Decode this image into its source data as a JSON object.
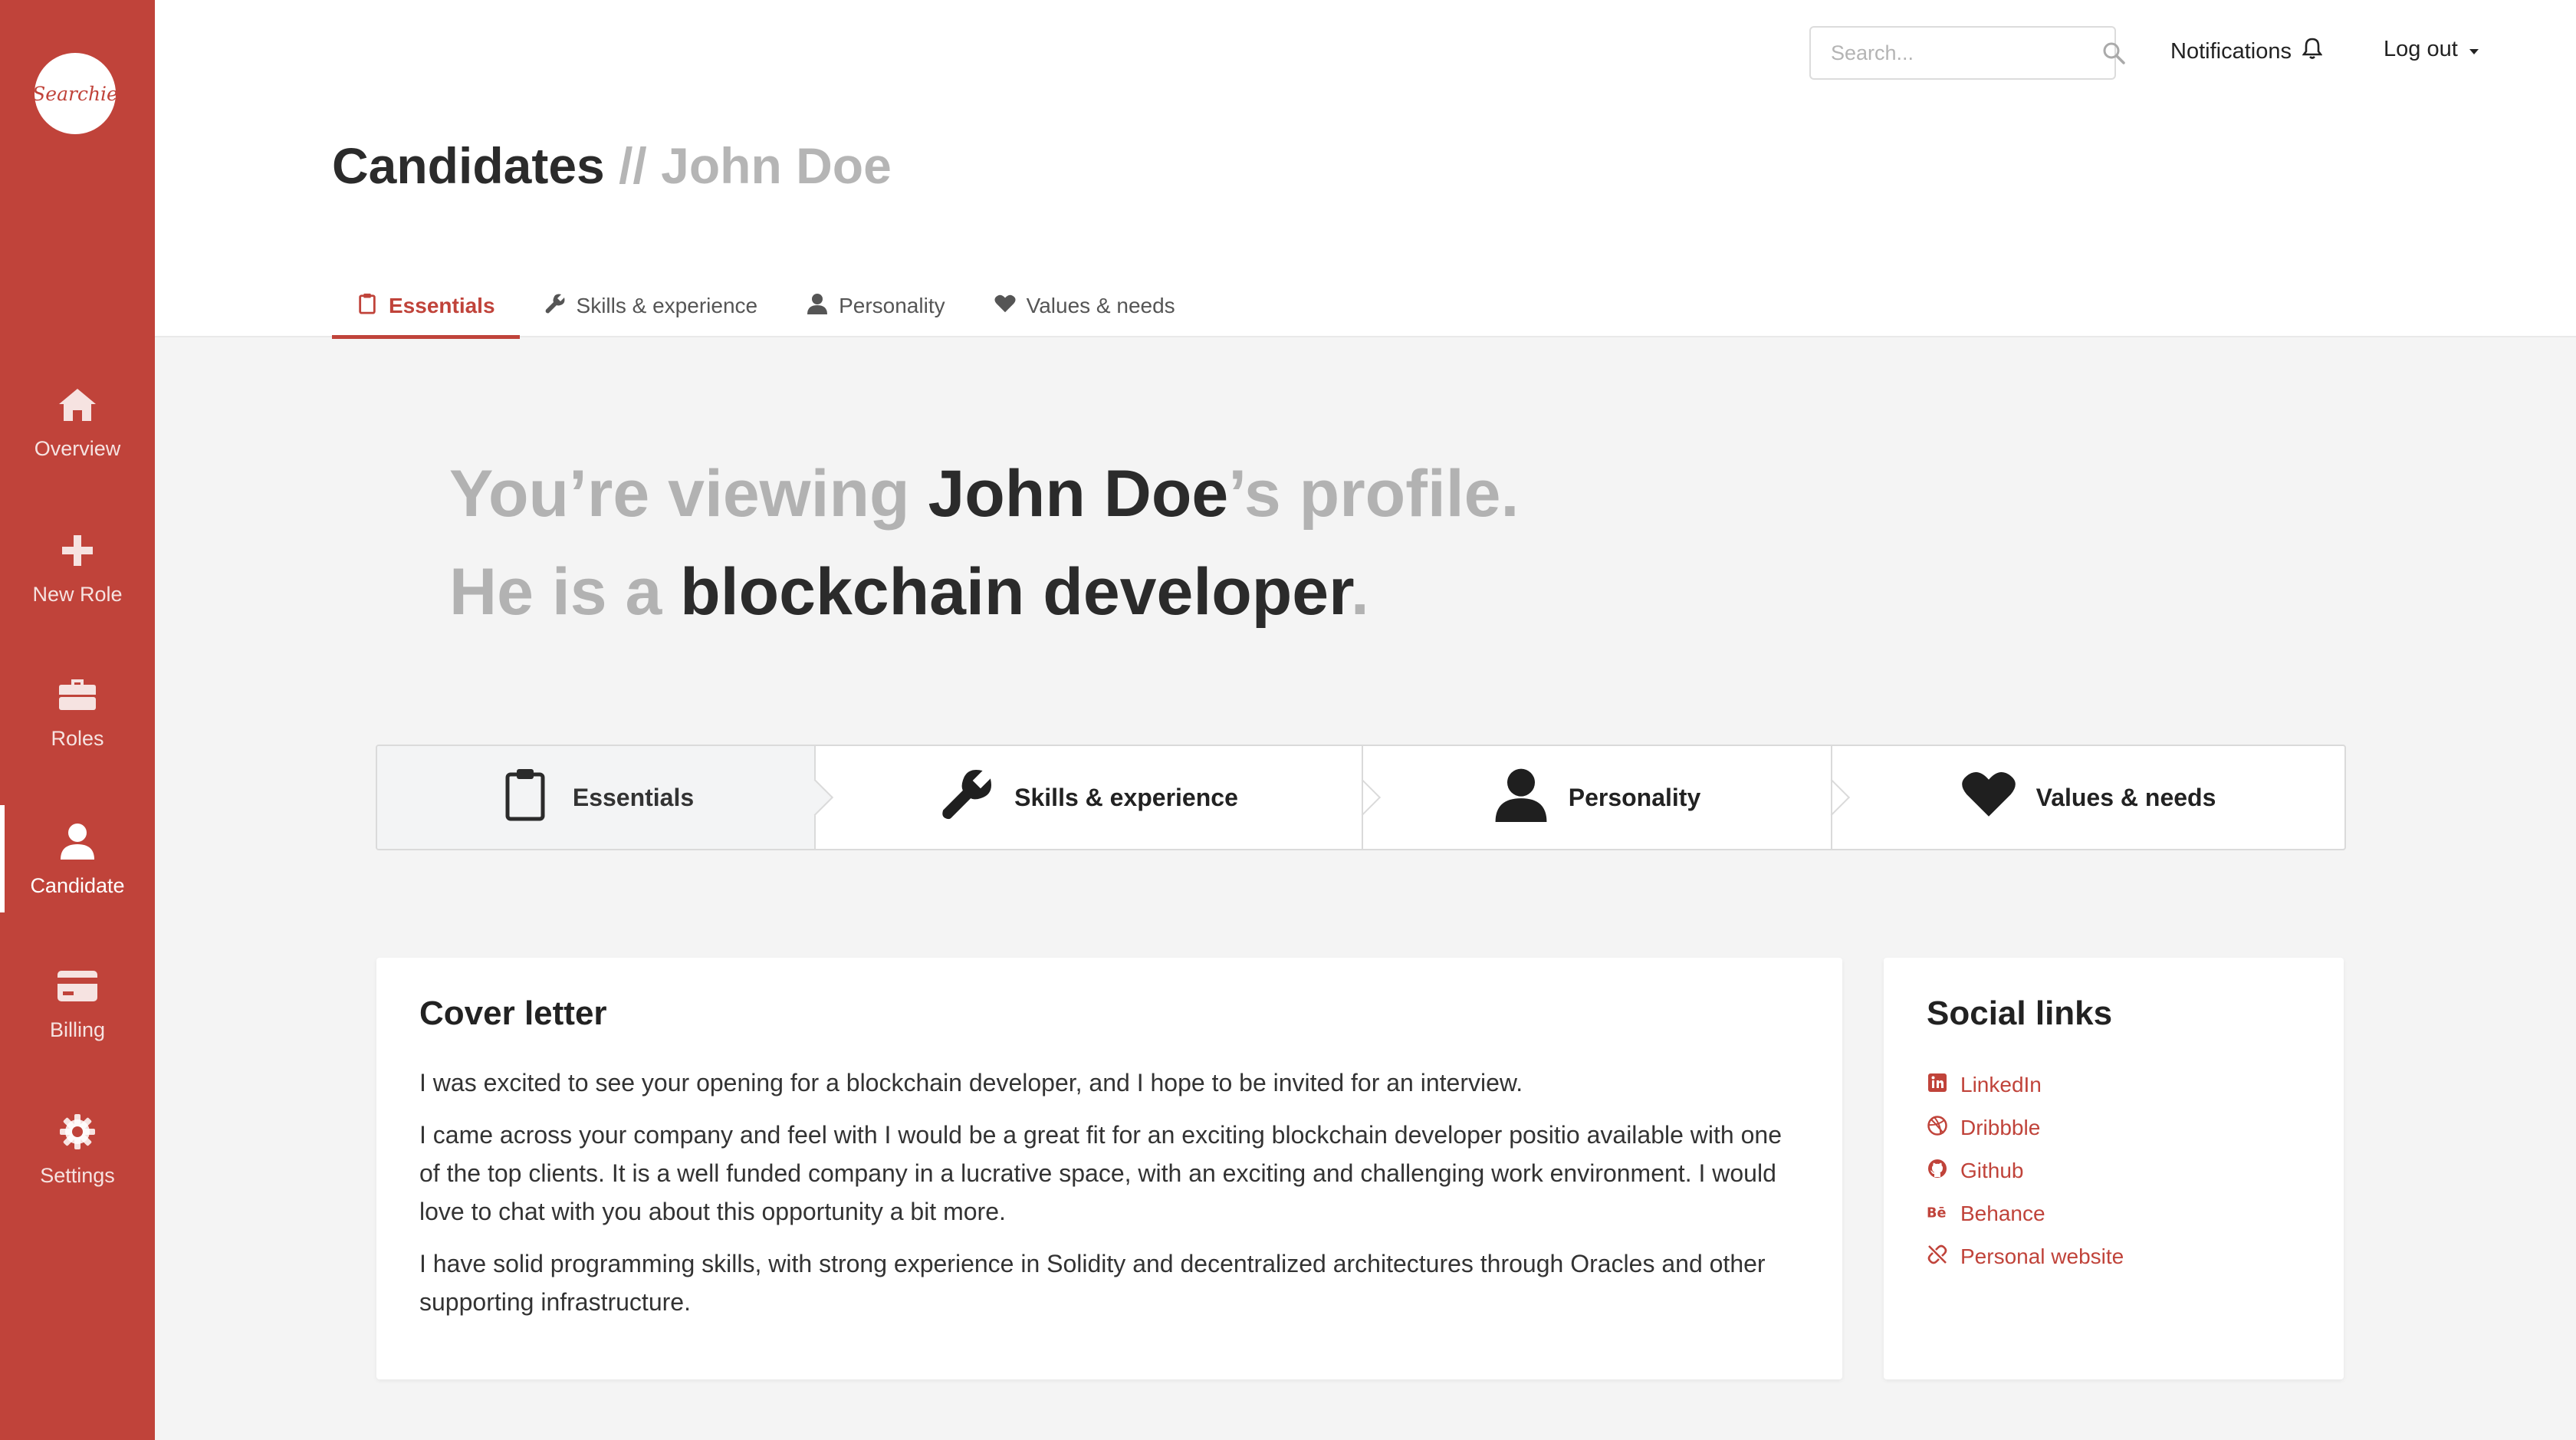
{
  "brand": {
    "logo_text": "Searchie",
    "accent": "#c0433a"
  },
  "sidebar": {
    "items": [
      {
        "label": "Overview",
        "icon": "home-icon"
      },
      {
        "label": "New Role",
        "icon": "plus-icon"
      },
      {
        "label": "Roles",
        "icon": "briefcase-icon"
      },
      {
        "label": "Candidate",
        "icon": "user-icon",
        "active": true
      },
      {
        "label": "Billing",
        "icon": "credit-card-icon"
      },
      {
        "label": "Settings",
        "icon": "gear-icon"
      }
    ]
  },
  "header": {
    "search_placeholder": "Search...",
    "notifications_label": "Notifications",
    "logout_label": "Log out",
    "title": "Candidates",
    "title_separator": "//",
    "title_sub": "John Doe",
    "tabs": [
      {
        "label": "Essentials",
        "icon": "clipboard-icon",
        "active": true
      },
      {
        "label": "Skills & experience",
        "icon": "wrench-icon"
      },
      {
        "label": "Personality",
        "icon": "user-icon"
      },
      {
        "label": "Values & needs",
        "icon": "heart-icon"
      }
    ]
  },
  "hero": {
    "line1_prefix": "You’re viewing ",
    "name": "John Doe",
    "line1_suffix": "’s profile.",
    "line2_prefix": "He is a ",
    "role": "blockchain developer",
    "line2_suffix": "."
  },
  "steps": [
    {
      "label": "Essentials",
      "icon": "clipboard-icon",
      "active": true
    },
    {
      "label": "Skills & experience",
      "icon": "wrench-icon"
    },
    {
      "label": "Personality",
      "icon": "user-icon"
    },
    {
      "label": "Values & needs",
      "icon": "heart-icon"
    }
  ],
  "cover_letter": {
    "title": "Cover letter",
    "paragraphs": [
      "I was excited to see your opening for a blockchain developer, and I hope to be invited for an interview.",
      "I came across your company and feel with I would be a great fit for an exciting blockchain developer positio available with one of the top clients. It is a well funded company in a lucrative space, with an exciting and challenging work environment. I would love to chat with you about this opportunity a bit more.",
      "I have solid programming skills, with strong experience in Solidity and decentralized architectures through Oracles and other supporting infrastructure."
    ]
  },
  "social": {
    "title": "Social links",
    "links": [
      {
        "label": "LinkedIn",
        "icon": "linkedin-icon"
      },
      {
        "label": "Dribbble",
        "icon": "dribbble-icon"
      },
      {
        "label": "Github",
        "icon": "github-icon"
      },
      {
        "label": "Behance",
        "icon": "behance-icon"
      },
      {
        "label": "Personal website",
        "icon": "unlink-icon"
      }
    ]
  }
}
